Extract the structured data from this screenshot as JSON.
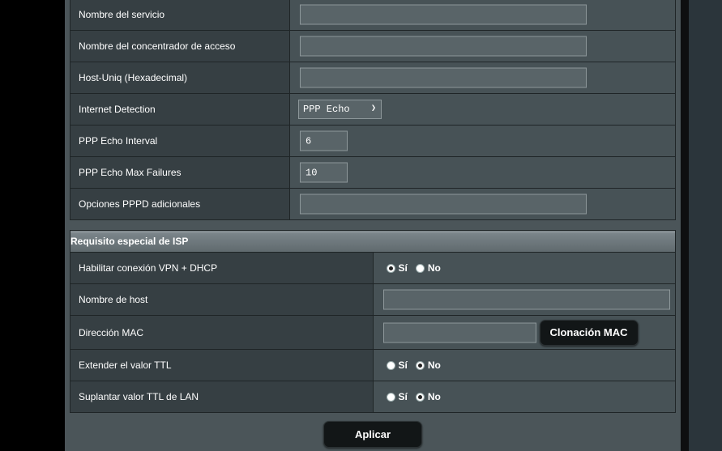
{
  "pppoe": {
    "service_name_label": "Nombre del servicio",
    "service_name_value": "",
    "ac_name_label": "Nombre del concentrador de acceso",
    "ac_name_value": "",
    "host_uniq_label": "Host-Uniq (Hexadecimal)",
    "host_uniq_value": "",
    "internet_detection_label": "Internet Detection",
    "internet_detection_value": "PPP Echo",
    "echo_interval_label": "PPP Echo Interval",
    "echo_interval_value": "6",
    "echo_max_failures_label": "PPP Echo Max Failures",
    "echo_max_failures_value": "10",
    "pppd_options_label": "Opciones PPPD adicionales",
    "pppd_options_value": ""
  },
  "isp": {
    "section_title": "Requisito especial de ISP",
    "vpn_dhcp_label": "Habilitar conexión VPN + DHCP",
    "vpn_dhcp_selected": "Sí",
    "hostname_label": "Nombre de host",
    "hostname_value": "",
    "mac_label": "Dirección MAC",
    "mac_value": "",
    "mac_clone_button": "Clonación MAC",
    "ttl_extend_label": "Extender el valor TTL",
    "ttl_extend_selected": "No",
    "ttl_spoof_label": "Suplantar valor TTL de LAN",
    "ttl_spoof_selected": "No"
  },
  "radio_options": {
    "yes": "Sí",
    "no": "No"
  },
  "apply_button": "Aplicar"
}
